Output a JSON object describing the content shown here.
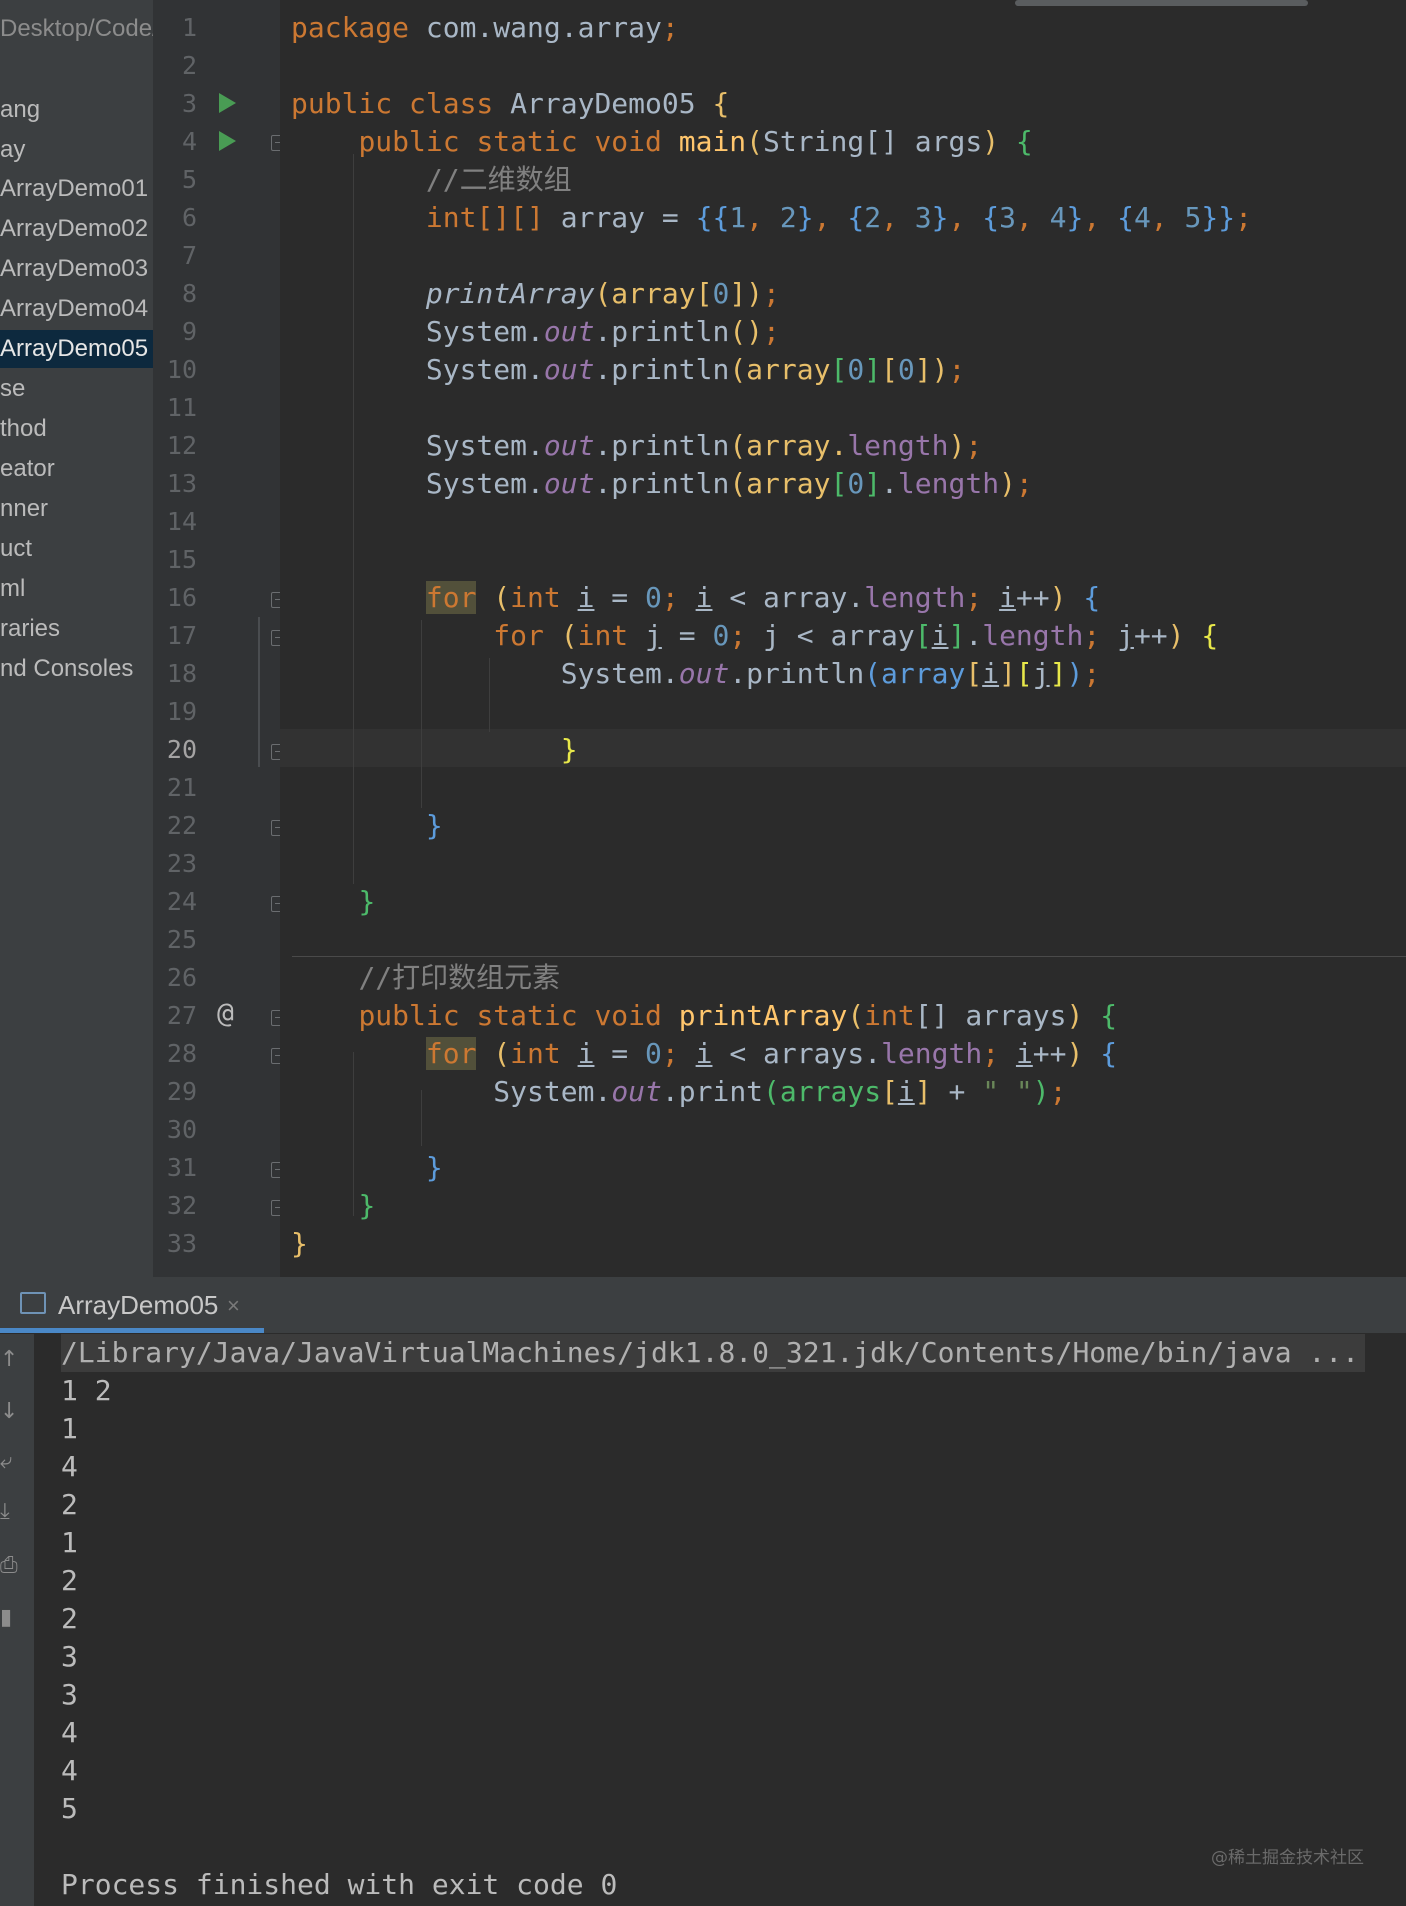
{
  "sidebar": {
    "path_fragment": "Desktop/Code/",
    "items": [
      "ang",
      "ay",
      "ArrayDemo01",
      "ArrayDemo02",
      "ArrayDemo03",
      "ArrayDemo04",
      "ArrayDemo05",
      "se",
      "thod",
      "eator",
      "nner",
      "uct",
      "ml",
      "raries",
      "nd Consoles"
    ],
    "selected_index": 6
  },
  "editor": {
    "current_line": 20,
    "line_numbers": [
      "1",
      "2",
      "3",
      "4",
      "5",
      "6",
      "7",
      "8",
      "9",
      "10",
      "11",
      "12",
      "13",
      "14",
      "15",
      "16",
      "17",
      "18",
      "19",
      "20",
      "21",
      "22",
      "23",
      "24",
      "25",
      "26",
      "27",
      "28",
      "29",
      "30",
      "31",
      "32",
      "33"
    ],
    "code": {
      "l1_kw": "package",
      "l1_pkg": "com.wang.array",
      "l1_semi": ";",
      "l3_kw": "public class",
      "l3_name": "ArrayDemo05",
      "l3_brace": "{",
      "l4_kw": "public static void",
      "l4_fn": "main",
      "l4_open": "(",
      "l4_params": "String[] args",
      "l4_close": ")",
      "l4_brace": "{",
      "l5_cmt": "//二维数组",
      "l6_type": "int[][]",
      "l6_var": " array = ",
      "l6_o": "{",
      "l6_e1o": "{",
      "l6_n1": "1",
      "l6_c1": ", ",
      "l6_n2": "2",
      "l6_e1c": "}",
      "l6_s1": ", ",
      "l6_e2o": "{",
      "l6_n3": "2",
      "l6_c2": ", ",
      "l6_n4": "3",
      "l6_e2c": "}",
      "l6_s2": ", ",
      "l6_e3o": "{",
      "l6_n5": "3",
      "l6_c3": ", ",
      "l6_n6": "4",
      "l6_e3c": "}",
      "l6_s3": ", ",
      "l6_e4o": "{",
      "l6_n7": "4",
      "l6_c4": ", ",
      "l6_n8": "5",
      "l6_e4c": "}",
      "l6_c": "}",
      "l6_semi": ";",
      "l8_fn": "printArray",
      "l8_a": "(array",
      "l8_b": "[",
      "l8_n": "0",
      "l8_bc": "]",
      "l8_c": ")",
      "l8_semi": ";",
      "sys": "System.",
      "out": "out",
      "println": ".println",
      "print": ".print",
      "l9_args": "()",
      "l10_args_a": "(array",
      "l10_b1": "[",
      "l10_n1": "0",
      "l10_bc1": "]",
      "l10_b2": "[",
      "l10_n2": "0",
      "l10_bc2": "]",
      "l10_c": ")",
      "semi": ";",
      "l12_a": "(array.",
      "length": "length",
      "l12_c": ")",
      "l13_a": "(array",
      "l13_b": "[",
      "l13_n": "0",
      "l13_bc": "]",
      "l13_dot": ".",
      "l13_c": ")",
      "for": "for",
      "l16_a": " (",
      "l16_int": "int",
      "i": "i",
      "j": "j",
      "eq": " = ",
      "zero": "0",
      "sc": "; ",
      "lt": " < ",
      "arr_dot": "array.",
      "inc": "++",
      "l16_c": ")",
      "l16_brace": "{",
      "l17_arr": "array",
      "l17_b": "[",
      "l17_bc": "]",
      "l17_dot": ".",
      "l17_brace": "{",
      "l18_a": "(array",
      "l18_b1": "[",
      "l18_bc1": "]",
      "l18_b2": "[",
      "l18_bc2": "]",
      "l18_c": ")",
      "l20_brace": "}",
      "l22_brace": "}",
      "l24_brace": "}",
      "l26_cmt": "//打印数组元素",
      "l27_kw": "public static void",
      "l27_fn": "printArray",
      "l27_o": "(",
      "l27_int": "int",
      "l27_params": "[] arrays",
      "l27_c": ")",
      "l27_brace": "{",
      "l28_arr": "arrays.",
      "l28_c": ")",
      "l28_brace": "{",
      "l29_a": "(arrays",
      "l29_b": "[",
      "l29_bc": "]",
      "l29_plus": " + ",
      "l29_str": "\" \"",
      "l29_c": ")",
      "l31_brace": "}",
      "l32_brace": "}",
      "l33_brace": "}"
    }
  },
  "run_panel": {
    "tab_label": "ArrayDemo05",
    "tab_close": "×",
    "tool_icons": [
      "up-arrow-icon",
      "down-arrow-icon",
      "soft-wrap-icon",
      "scroll-to-end-icon",
      "print-icon",
      "trash-icon"
    ],
    "command": "/Library/Java/JavaVirtualMachines/jdk1.8.0_321.jdk/Contents/Home/bin/java ...",
    "output": [
      "1 2",
      "1",
      "4",
      "2",
      "1",
      "2",
      "2",
      "3",
      "3",
      "4",
      "4",
      "5"
    ],
    "finished": "Process finished with exit code 0"
  },
  "watermark": "@稀土掘金技术社区",
  "colors": {
    "background": "#2b2b2b",
    "keyword": "#cc7832",
    "number": "#6897bb",
    "comment": "#808080",
    "function": "#ffc66d",
    "field": "#9876aa",
    "string": "#6a8759",
    "selection": "#0d293e",
    "run_icon": "#499c54"
  }
}
